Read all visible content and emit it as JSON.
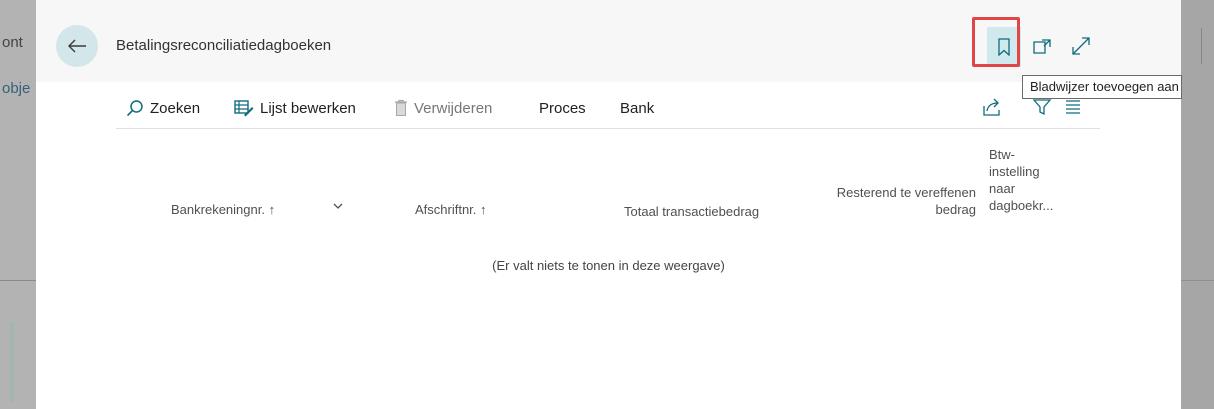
{
  "background": {
    "left_text_1": "ont",
    "left_text_2": "obje"
  },
  "header": {
    "title": "Betalingsreconciliatiedagboeken"
  },
  "tooltip": {
    "text": "Bladwijzer toevoegen aan uw"
  },
  "actions": [
    {
      "label": "Zoeken",
      "icon": "search-icon"
    },
    {
      "label": "Lijst bewerken",
      "icon": "edit-list-icon"
    },
    {
      "label": "Verwijderen",
      "icon": "trash-icon",
      "disabled": true
    },
    {
      "label": "Proces"
    },
    {
      "label": "Bank"
    }
  ],
  "columns": {
    "bank_account": "Bankrekeningnr. ↑",
    "statement": "Afschriftnr. ↑",
    "total": "Totaal transactiebedrag",
    "remaining_1": "Resterend te vereffenen",
    "remaining_2": "bedrag",
    "vat_1": "Btw-",
    "vat_2": "instelling",
    "vat_3": "naar",
    "vat_4": "dagboekr..."
  },
  "empty_message": "(Er valt niets te tonen in deze weergave)",
  "colors": {
    "accent": "#0f6c7e",
    "highlight": "#e04646",
    "back_button_bg": "#d3e6ea"
  }
}
